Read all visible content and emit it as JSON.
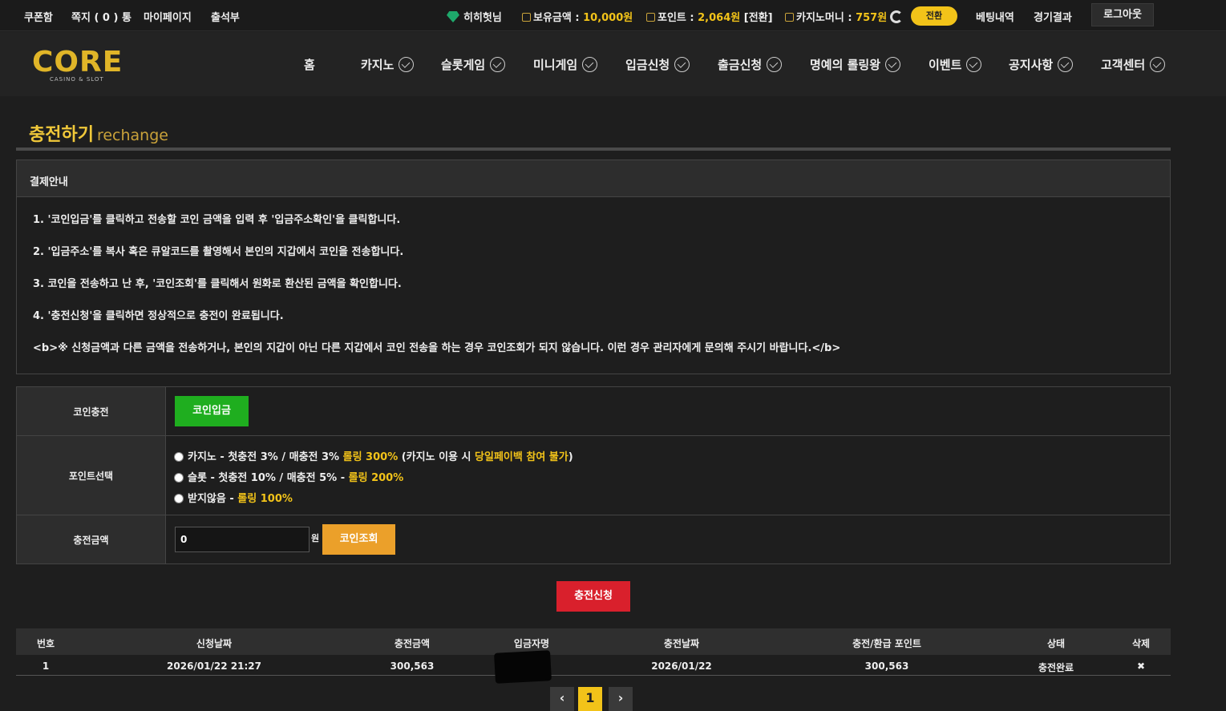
{
  "topbar": {
    "coupon": "쿠폰함",
    "message": "쪽지 ( 0 ) 통",
    "mypage": "마이페이지",
    "attendance": "출석부",
    "username": "히히헛님",
    "balance_label": "보유금액 :",
    "balance_value": "10,000원",
    "point_label": "포인트 :",
    "point_value": "2,064원",
    "point_convert": "[전환]",
    "casino_label": "카지노머니 :",
    "casino_value": "757원",
    "convert_button": "전환",
    "betting_history": "베팅내역",
    "game_results": "경기결과",
    "logout": "로그아웃"
  },
  "logo": {
    "text": "CORE",
    "subtext": "CASINO & SLOT"
  },
  "nav": {
    "home": "홈",
    "casino": "카지노",
    "slot": "슬롯게임",
    "minigame": "미니게임",
    "deposit": "입금신청",
    "withdraw": "출금신청",
    "rolling_hall": "명예의 롤링왕",
    "event": "이벤트",
    "notice": "공지사항",
    "support": "고객센터"
  },
  "page": {
    "title_ko": "충전하기",
    "title_en": "rechange"
  },
  "guide": {
    "heading": "결제안내",
    "lines": [
      "1. '코인입금'를 클릭하고 전송할 코인 금액을 입력 후 '입금주소확인'을 클릭합니다.",
      "2. '입금주소'를 복사 혹은 큐알코드를 촬영해서 본인의 지갑에서 코인을 전송합니다.",
      "3. 코인을 전송하고 난 후, '코인조회'를 클릭해서 원화로 환산된 금액을 확인합니다.",
      "4. '충전신청'을 클릭하면 정상적으로 충전이 완료됩니다.",
      "<b>※ 신청금액과 다른 금액을 전송하거나, 본인의 지갑이 아닌 다른 지갑에서 코인 전송을 하는 경우 코인조회가 되지 않습니다. 이런 경우 관리자에게 문의해 주시기 바랍니다.</b>"
    ]
  },
  "form": {
    "coin_label": "코인충전",
    "coin_button": "코인입금",
    "point_label": "포인트선택",
    "options": [
      {
        "main": "카지노 - 첫충전 3% / 매충전 3% ",
        "rolling": "롤링 300%",
        "pre": " (카지노 이용 시 ",
        "warn": "당일페이백 참여 불가",
        "post": ")"
      },
      {
        "main": "슬롯 - 첫충전 10% / 매충전 5% - ",
        "rolling": "롤링 200%",
        "pre": "",
        "warn": "",
        "post": ""
      },
      {
        "main": "받지않음 - ",
        "rolling": "롤링 100%",
        "pre": "",
        "warn": "",
        "post": ""
      }
    ],
    "amount_label": "충전금액",
    "amount_value": "0",
    "won": "원",
    "coin_check_button": "코인조회"
  },
  "submit_button": "충전신청",
  "table": {
    "headers": [
      "번호",
      "신청날짜",
      "충전금액",
      "입금자명",
      "충전날짜",
      "충전/환급 포인트",
      "상태",
      "삭제"
    ],
    "rows": [
      [
        "1",
        "2026/01/22 21:27",
        "300,563",
        "",
        "2026/01/22",
        "300,563",
        "충전완료",
        "✖"
      ]
    ]
  },
  "pagination": {
    "prev": "‹",
    "current": "1",
    "next": "›"
  }
}
